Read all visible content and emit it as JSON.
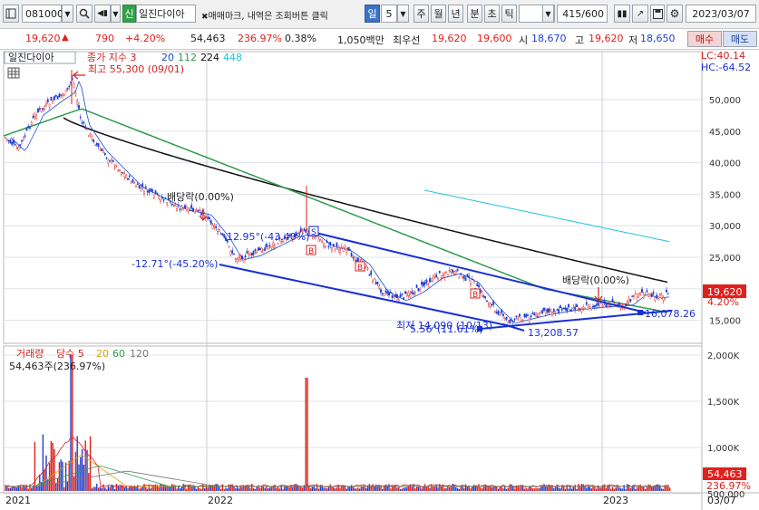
{
  "toolbar": {
    "code": "081000",
    "name_badge": "신",
    "name": "일진다이아",
    "marquee": "매매마크, 내역은 조회버튼 클릭",
    "period_selected": "일",
    "period_count": "5",
    "periods": [
      "주",
      "월",
      "년",
      "분",
      "초",
      "틱"
    ],
    "count_display": "415/600",
    "date": "2023/03/07"
  },
  "quote": {
    "price": "19,620",
    "change_arrow": "▲",
    "change": "790",
    "change_pct": "+4.20%",
    "volume": "54,463",
    "volume_ratio": "236.97%",
    "turnover": "0.38%",
    "amount": "1,050백만",
    "best_ask_label": "최우선",
    "best_ask": "19,620",
    "best_bid": "19,600",
    "open_label": "시",
    "open": "18,670",
    "high_label": "고",
    "high": "19,620",
    "low_label": "저",
    "low": "18,650",
    "buy_label": "매수",
    "sell_label": "매도"
  },
  "price_panel": {
    "title": "일진다이아",
    "legend_prefix": "종가 지수 3",
    "ma_labels": [
      "20",
      "112",
      "224",
      "448"
    ],
    "ma_colors": [
      "#1c4fd0",
      "#2e9b4e",
      "#111111",
      "#22c4d8"
    ],
    "high_note": "최고 55,300 (09/01)",
    "lc": "LC:40.14",
    "hc": "HC:-64.52",
    "y_ticks": [
      "50,000",
      "45,000",
      "40,000",
      "35,000",
      "30,000",
      "25,000",
      "20,000",
      "15,000"
    ],
    "current_price_tag": "19,620",
    "current_pct": "4.20%",
    "annotations": {
      "dividend1": "배당락(0.00%)",
      "dividend2": "배당락(0.00%)",
      "trend1": "-12.95°(-43.40%)",
      "trend2": "-12.71°(-45.20%)",
      "low_note": "최저 14,090 (10/13)",
      "angle_note": "5.56°(11.61%)",
      "level1": "13,208.57",
      "level2": "16,078.26"
    }
  },
  "volume_panel": {
    "title": "거래량",
    "legend": "당수 5",
    "ma_labels": [
      "20",
      "60",
      "120"
    ],
    "ma_colors": [
      "#e0a000",
      "#2e9b4e",
      "#888888"
    ],
    "current": "54,463주(236.97%)",
    "y_ticks": [
      "2,000K",
      "1,500K",
      "1,000K",
      "500,000"
    ],
    "current_tag": "54,463",
    "current_pct_tag": "236.97%"
  },
  "x_axis": {
    "labels": [
      "2021",
      "2022",
      "2023",
      "03/07"
    ]
  },
  "colors": {
    "up": "#e0201b",
    "down": "#1f3fd0",
    "accent": "#3a73c4"
  }
}
